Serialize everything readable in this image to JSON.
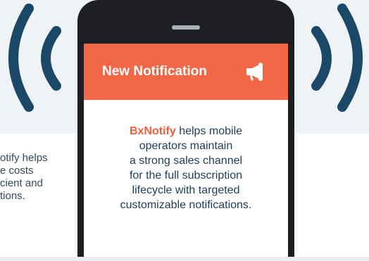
{
  "background_text": {
    "lines": [
      "otify helps",
      "e costs",
      "cient and",
      "tions."
    ]
  },
  "notification": {
    "title": "New Notification",
    "icon": "megaphone-icon"
  },
  "message": {
    "brand": "BxNotify",
    "line1_rest": " helps mobile",
    "line2": "operators maintain",
    "line3": "a  strong sales channel",
    "line4": "for the full subscription",
    "line5": "lifecycle with targeted",
    "line6": "customizable notifications."
  },
  "colors": {
    "accent": "#f26847",
    "brand_text": "#e8613f",
    "wave": "#1c4868",
    "text": "#1f3d5a",
    "phone_body": "#1d1f22",
    "band": "#f0f3f6"
  }
}
